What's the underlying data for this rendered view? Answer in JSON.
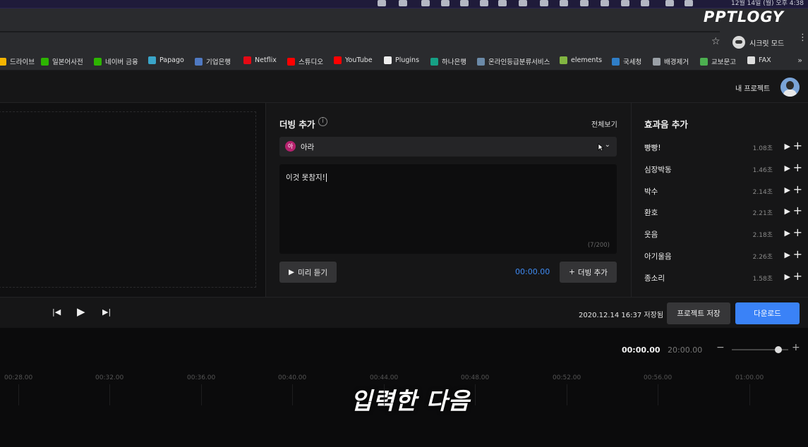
{
  "os_menubar": {
    "clock": "12월 14일 (월) 오후 4:38",
    "status_icons": [
      "status-icon",
      "status-icon",
      "status-icon",
      "status-icon",
      "status-icon",
      "status-icon",
      "status-icon",
      "status-icon",
      "status-icon",
      "status-icon",
      "status-icon",
      "status-icon",
      "status-icon",
      "status-icon",
      "status-icon",
      "status-icon"
    ]
  },
  "watermark": "PPTLOGY",
  "browser": {
    "incognito_label": "시크릿 모드",
    "bookmarks": [
      {
        "label": "드라이브",
        "color": "#f4b400"
      },
      {
        "label": "일본어사전",
        "color": "#2db400"
      },
      {
        "label": "네이버 금융",
        "color": "#2db400"
      },
      {
        "label": "Papago",
        "color": "#3aa5c9"
      },
      {
        "label": "기업은행",
        "color": "#4f79c2"
      },
      {
        "label": "Netflix",
        "color": "#e50914"
      },
      {
        "label": "스튜디오",
        "color": "#ff0000"
      },
      {
        "label": "YouTube",
        "color": "#ff0000"
      },
      {
        "label": "Plugins",
        "color": "#eeeeee"
      },
      {
        "label": "하나은행",
        "color": "#16a085"
      },
      {
        "label": "온라인등급분류서비스",
        "color": "#6b8aa8"
      },
      {
        "label": "elements",
        "color": "#82b541"
      },
      {
        "label": "국세청",
        "color": "#2f7ec7"
      },
      {
        "label": "배경제거",
        "color": "#9aa0a6"
      },
      {
        "label": "교보문고",
        "color": "#4caf50"
      },
      {
        "label": "FAX",
        "color": "#dddddd"
      }
    ],
    "more": "»"
  },
  "app": {
    "my_projects": "내 프로젝트",
    "dubbing": {
      "title": "더빙 추가",
      "view_all": "전체보기",
      "voice_badge": "아",
      "voice_name": "아라",
      "text_value": "이것 못참지!",
      "char_count": "(7/200)",
      "preview_label": "미리 듣기",
      "timecode": "00:00.00",
      "add_label": "더빙 추가"
    },
    "sfx": {
      "title": "효과음 추가",
      "items": [
        {
          "name": "빵빵!",
          "duration": "1.08초"
        },
        {
          "name": "심장박동",
          "duration": "1.46초"
        },
        {
          "name": "박수",
          "duration": "2.14초"
        },
        {
          "name": "환호",
          "duration": "2.21초"
        },
        {
          "name": "웃음",
          "duration": "2.18초"
        },
        {
          "name": "아기울음",
          "duration": "2.26초"
        },
        {
          "name": "종소리",
          "duration": "1.58초"
        }
      ]
    },
    "transport": {
      "saved_text": "2020.12.14 16:37 저장됨",
      "save_label": "프로젝트 저장",
      "download_label": "다운로드"
    },
    "timeline": {
      "current": "00:00.00",
      "total": "20:00.00",
      "zoom_level": 0.82,
      "ticks": [
        "00:28.00",
        "00:32.00",
        "00:36.00",
        "00:40.00",
        "00:44.00",
        "00:48.00",
        "00:52.00",
        "00:56.00",
        "01:00.00"
      ]
    }
  },
  "subtitle": "입력한 다음"
}
